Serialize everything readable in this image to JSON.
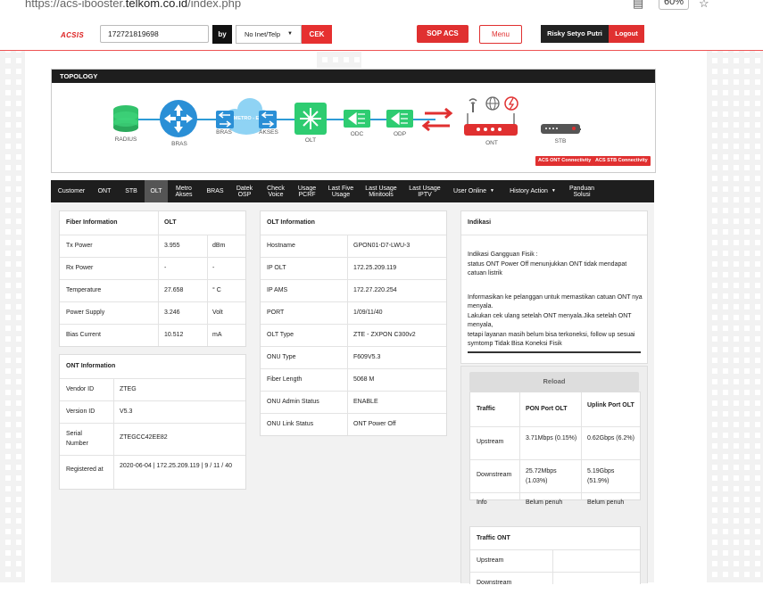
{
  "browser": {
    "url_prefix": "https://acs-ibooster.",
    "url_domain": "telkom.co.id",
    "url_path": "/index.php",
    "zoom": "60%"
  },
  "header": {
    "logo": "ACSIS",
    "search_value": "172721819698",
    "by_label": "by",
    "select_value": "No Inet/Telp",
    "cek_label": "CEK",
    "sop_label": "SOP ACS",
    "menu_label": "Menu",
    "user_name": "Risky Setyo Putri",
    "logout_label": "Logout"
  },
  "topology": {
    "title": "TOPOLOGY",
    "nodes": [
      "RADIUS",
      "BRAS",
      "BRAS",
      "METRO - E",
      "AKSES",
      "OLT",
      "ODC",
      "ODP",
      "ONT",
      "STB"
    ],
    "badges": [
      "ACS ONT Connectivity",
      "ACS STB Connectivity"
    ],
    "colors": {
      "accent": "#e03030",
      "link": "#2e9bd6",
      "green": "#2ecc71"
    }
  },
  "tabs": [
    {
      "label": "Customer"
    },
    {
      "label": "ONT"
    },
    {
      "label": "STB"
    },
    {
      "label": "OLT"
    },
    {
      "label": "Metro Akses"
    },
    {
      "label": "BRAS"
    },
    {
      "label": "Datek OSP"
    },
    {
      "label": "Check Voice"
    },
    {
      "label": "Usage PCRF"
    },
    {
      "label": "Last Five Usage"
    },
    {
      "label": "Last Usage Minitools"
    },
    {
      "label": "Last Usage IPTV"
    },
    {
      "label": "User Online"
    },
    {
      "label": "History Action"
    },
    {
      "label": "Panduan Solusi"
    }
  ],
  "fiber": {
    "title": "Fiber Information",
    "col": "OLT",
    "rows": [
      {
        "label": "Tx Power",
        "value": "3.955",
        "unit": "dBm"
      },
      {
        "label": "Rx Power",
        "value": "-",
        "unit": "-"
      },
      {
        "label": "Temperature",
        "value": "27.658",
        "unit": "° C"
      },
      {
        "label": "Power Supply",
        "value": "3.246",
        "unit": "Volt"
      },
      {
        "label": "Bias Current",
        "value": "10.512",
        "unit": "mA"
      }
    ]
  },
  "ont": {
    "title": "ONT Information",
    "rows": [
      {
        "label": "Vendor ID",
        "value": "ZTEG"
      },
      {
        "label": "Version ID",
        "value": "V5.3"
      },
      {
        "label": "Serial Number",
        "value": "ZTEGCC42EE82"
      },
      {
        "label": "Registered at",
        "value": "2020-06-04 | 172.25.209.119 | 9 / 11 / 40"
      }
    ]
  },
  "olt": {
    "title": "OLT Information",
    "rows": [
      {
        "label": "Hostname",
        "value": "GPON01-D7-LWU-3"
      },
      {
        "label": "IP OLT",
        "value": "172.25.209.119"
      },
      {
        "label": "IP AMS",
        "value": "172.27.220.254"
      },
      {
        "label": "PORT",
        "value": "1/09/11/40"
      },
      {
        "label": "OLT Type",
        "value": "ZTE - ZXPON C300v2"
      },
      {
        "label": "ONU Type",
        "value": "F609V5.3"
      },
      {
        "label": "Fiber Length",
        "value": "5068 M"
      },
      {
        "label": "ONU Admin Status",
        "value": "ENABLE"
      },
      {
        "label": "ONU Link Status",
        "value": "ONT Power Off"
      }
    ]
  },
  "indikasi": {
    "title": "Indikasi",
    "lines": [
      "Indikasi Gangguan Fisik :",
      "status ONT Power Off menunjukkan ONT tidak mendapat catuan listrik",
      "Informasikan ke pelanggan untuk memastikan catuan ONT nya menyala.",
      "Lakukan cek ulang setelah ONT menyala.Jika setelah ONT menyala,",
      "tetapi layanan masih belum bisa terkoneksi, follow up sesuai symtomp Tidak Bisa Koneksi Fisik"
    ]
  },
  "traffic": {
    "reload": "Reload",
    "headers": [
      "Traffic",
      "PON Port OLT",
      "Uplink Port OLT"
    ],
    "rows": [
      {
        "label": "Upstream",
        "pon": "3.71Mbps (0.15%)",
        "uplink": "0.62Gbps (6.2%)"
      },
      {
        "label": "Downstream",
        "pon": "25.72Mbps (1.03%)",
        "uplink": "5.19Gbps (51.9%)"
      },
      {
        "label": "Info",
        "pon": "Belum penuh",
        "uplink": "Belum penuh"
      }
    ],
    "ont_title": "Traffic ONT",
    "ont_rows": [
      "Upstream",
      "Downstream"
    ]
  }
}
